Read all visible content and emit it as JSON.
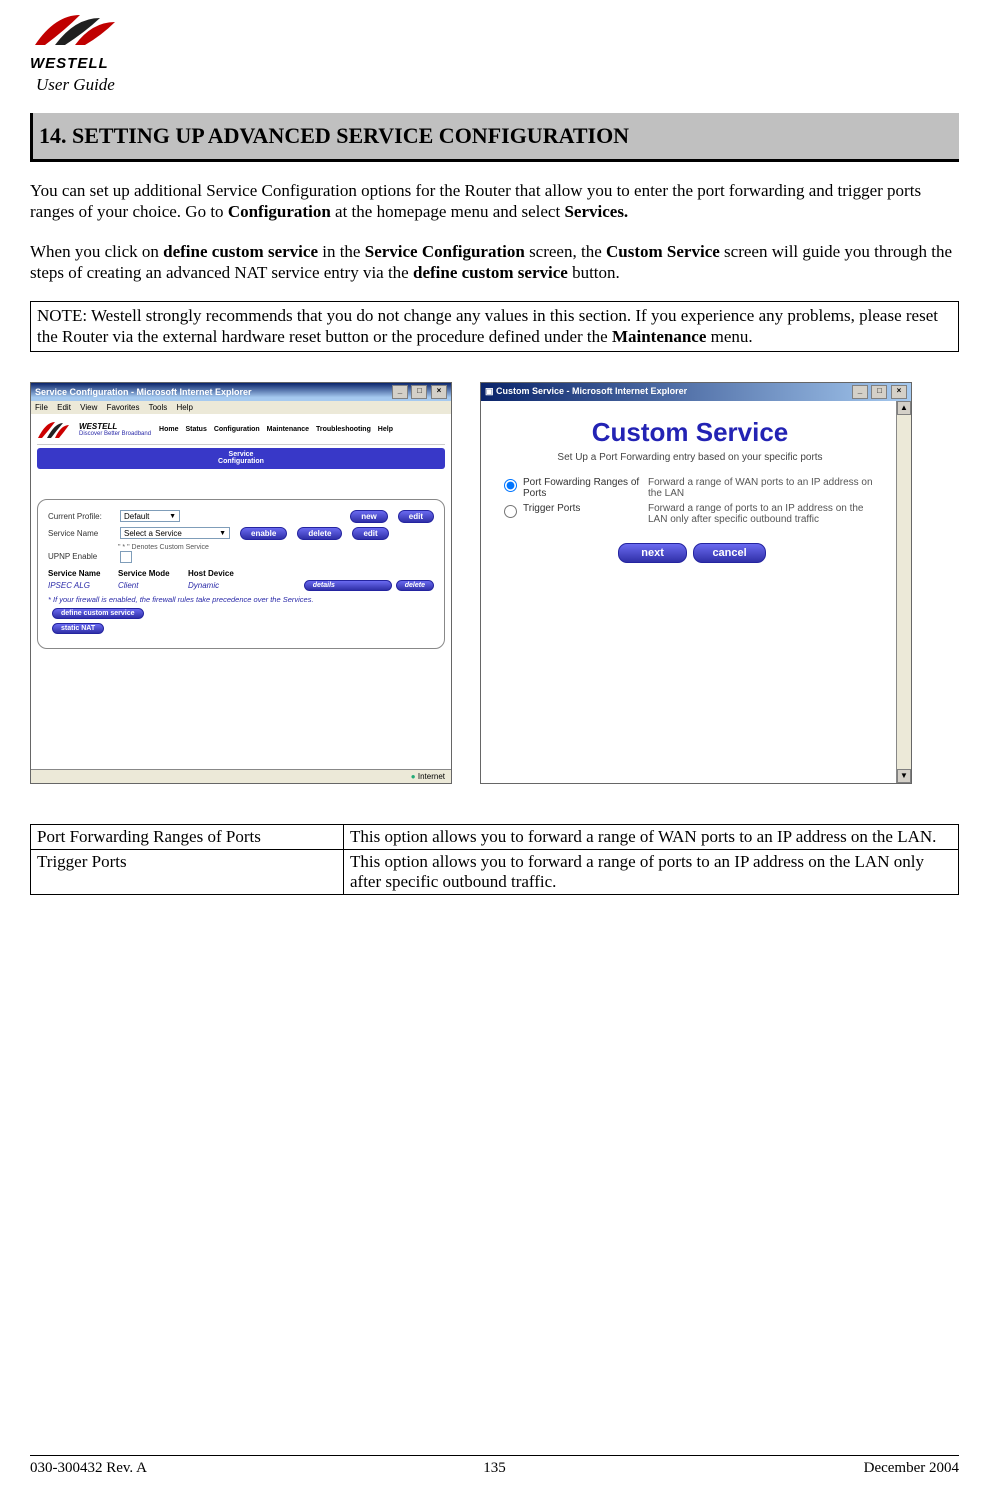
{
  "header": {
    "brand_line1": "WESTELL",
    "doc_title": "User Guide"
  },
  "section": {
    "number_title": "14.  SETTING UP ADVANCED SERVICE CONFIGURATION"
  },
  "paragraphs": {
    "p1_a": "You can set up additional Service Configuration options for the Router that allow you to enter the port forwarding and trigger ports ranges of your choice. Go to ",
    "p1_b": "Configuration",
    "p1_c": " at the homepage menu and select ",
    "p1_d": "Services.",
    "p2_a": "When you click on ",
    "p2_b": "define custom service",
    "p2_c": " in the ",
    "p2_d": "Service Configuration",
    "p2_e": " screen, the ",
    "p2_f": "Custom Service",
    "p2_g": " screen will guide you through the steps of creating an advanced NAT service entry via the ",
    "p2_h": "define custom service",
    "p2_i": " button."
  },
  "note": {
    "a": "NOTE: Westell strongly recommends that you do not change any values in this section. If you experience any problems, please reset the Router via the external hardware reset button or the procedure defined under the ",
    "b": "Maintenance",
    "c": " menu."
  },
  "screenshot_left": {
    "title": "Service Configuration - Microsoft Internet Explorer",
    "menus": [
      "File",
      "Edit",
      "View",
      "Favorites",
      "Tools",
      "Help"
    ],
    "brand_tag": "Discover Better Broadband",
    "nav": [
      "Home",
      "Status",
      "Configuration",
      "Maintenance",
      "Troubleshooting",
      "Help"
    ],
    "tab_line1": "Service",
    "tab_line2": "Configuration",
    "current_profile_label": "Current Profile:",
    "current_profile_value": "Default",
    "service_name_label": "Service Name",
    "service_name_value": "Select a Service",
    "service_denote": "\" * \" Denotes Custom Service",
    "upnp_label": "UPNP Enable",
    "btn_new": "new",
    "btn_edit": "edit",
    "btn_enable": "enable",
    "btn_delete": "delete",
    "btn_details": "details",
    "cols": {
      "c1": "Service Name",
      "c2": "Service Mode",
      "c3": "Host Device"
    },
    "row": {
      "c1": "IPSEC ALG",
      "c2": "Client",
      "c3": "Dynamic"
    },
    "firewall_note": "* If your firewall is enabled, the firewall rules take precedence over the Services.",
    "btn_define": "define custom service",
    "btn_static": "static NAT",
    "status": "Internet"
  },
  "screenshot_right": {
    "title": "Custom Service - Microsoft Internet Explorer",
    "heading": "Custom Service",
    "sub": "Set Up a Port Forwarding entry based on your specific ports",
    "opt1_label": "Port Fowarding Ranges of Ports",
    "opt1_desc": "Forward a range of WAN ports to an IP address on the LAN",
    "opt2_label": "Trigger Ports",
    "opt2_desc": "Forward a range of ports to an IP address on the LAN only after specific outbound traffic",
    "btn_next": "next",
    "btn_cancel": "cancel"
  },
  "definitions": {
    "row1_term": "Port Forwarding Ranges of Ports",
    "row1_def": "This option allows you to forward a range of WAN ports to an IP address on the LAN.",
    "row2_term": "Trigger Ports",
    "row2_def": "This option allows you to forward a range of ports to an IP address on the LAN only after specific outbound traffic."
  },
  "footer": {
    "left": "030-300432 Rev. A",
    "center": "135",
    "right": "December 2004"
  }
}
